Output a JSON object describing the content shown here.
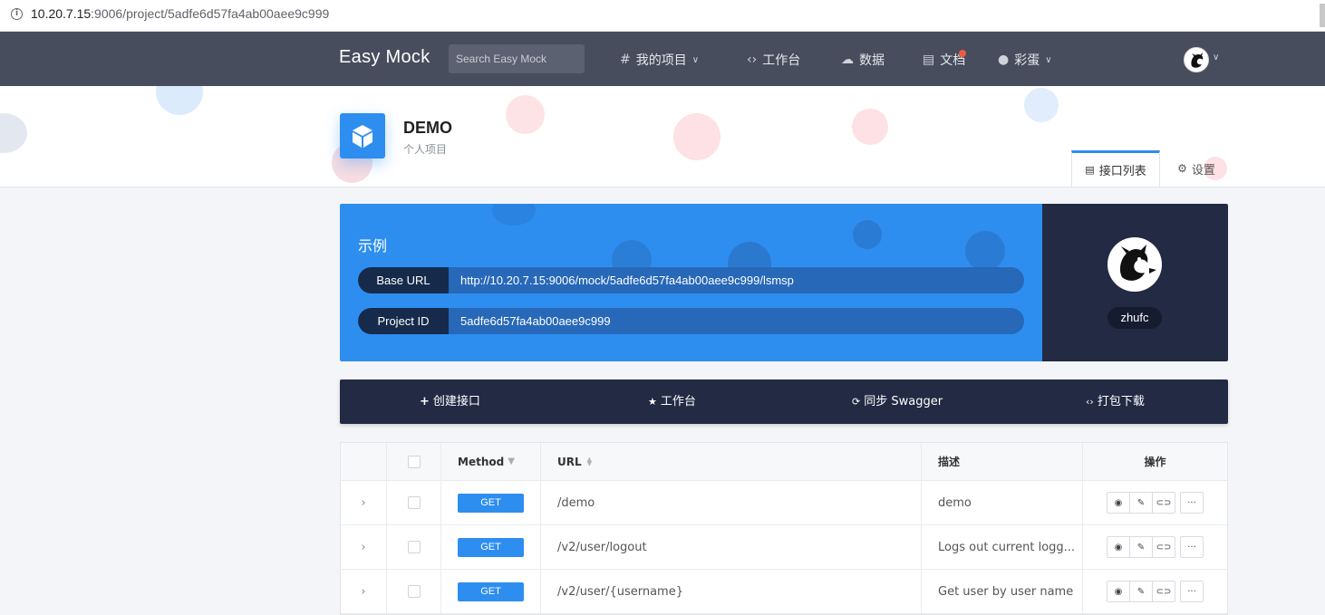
{
  "browser": {
    "url_host": "10.20.7.15",
    "url_rest": ":9006/project/5adfe6d57fa4ab00aee9c999"
  },
  "nav": {
    "brand": "Easy Mock",
    "search_placeholder": "Search Easy Mock",
    "items": [
      {
        "label": "我的项目",
        "icon": "hash-icon"
      },
      {
        "label": "工作台",
        "icon": "code-icon"
      },
      {
        "label": "数据",
        "icon": "cloud-icon"
      },
      {
        "label": "文档",
        "icon": "book-icon"
      },
      {
        "label": "彩蛋",
        "icon": "egg-icon"
      }
    ]
  },
  "project": {
    "title": "DEMO",
    "subtitle": "个人项目",
    "tabs": [
      {
        "label": "接口列表",
        "icon": "list-icon"
      },
      {
        "label": "设置",
        "icon": "gear-icon"
      }
    ]
  },
  "info": {
    "title": "示例",
    "base_url_label": "Base URL",
    "base_url": "http://10.20.7.15:9006/mock/5adfe6d57fa4ab00aee9c999/lsmsp",
    "project_id_label": "Project ID",
    "project_id": "5adfe6d57fa4ab00aee9c999"
  },
  "user": {
    "name": "zhufc"
  },
  "toolbar": {
    "create": "创建接口",
    "workbench": "工作台",
    "sync": "同步 Swagger",
    "download": "打包下载"
  },
  "table": {
    "headers": {
      "method": "Method",
      "url": "URL",
      "desc": "描述",
      "actions": "操作"
    },
    "rows": [
      {
        "method": "GET",
        "url": "/demo",
        "desc": "demo"
      },
      {
        "method": "GET",
        "url": "/v2/user/logout",
        "desc": "Logs out current logg..."
      },
      {
        "method": "GET",
        "url": "/v2/user/{username}",
        "desc": "Get user by user name"
      }
    ]
  },
  "colors": {
    "accent": "#2d8ef0",
    "nav_bg": "#474d5d",
    "dark_card": "#222a44"
  }
}
